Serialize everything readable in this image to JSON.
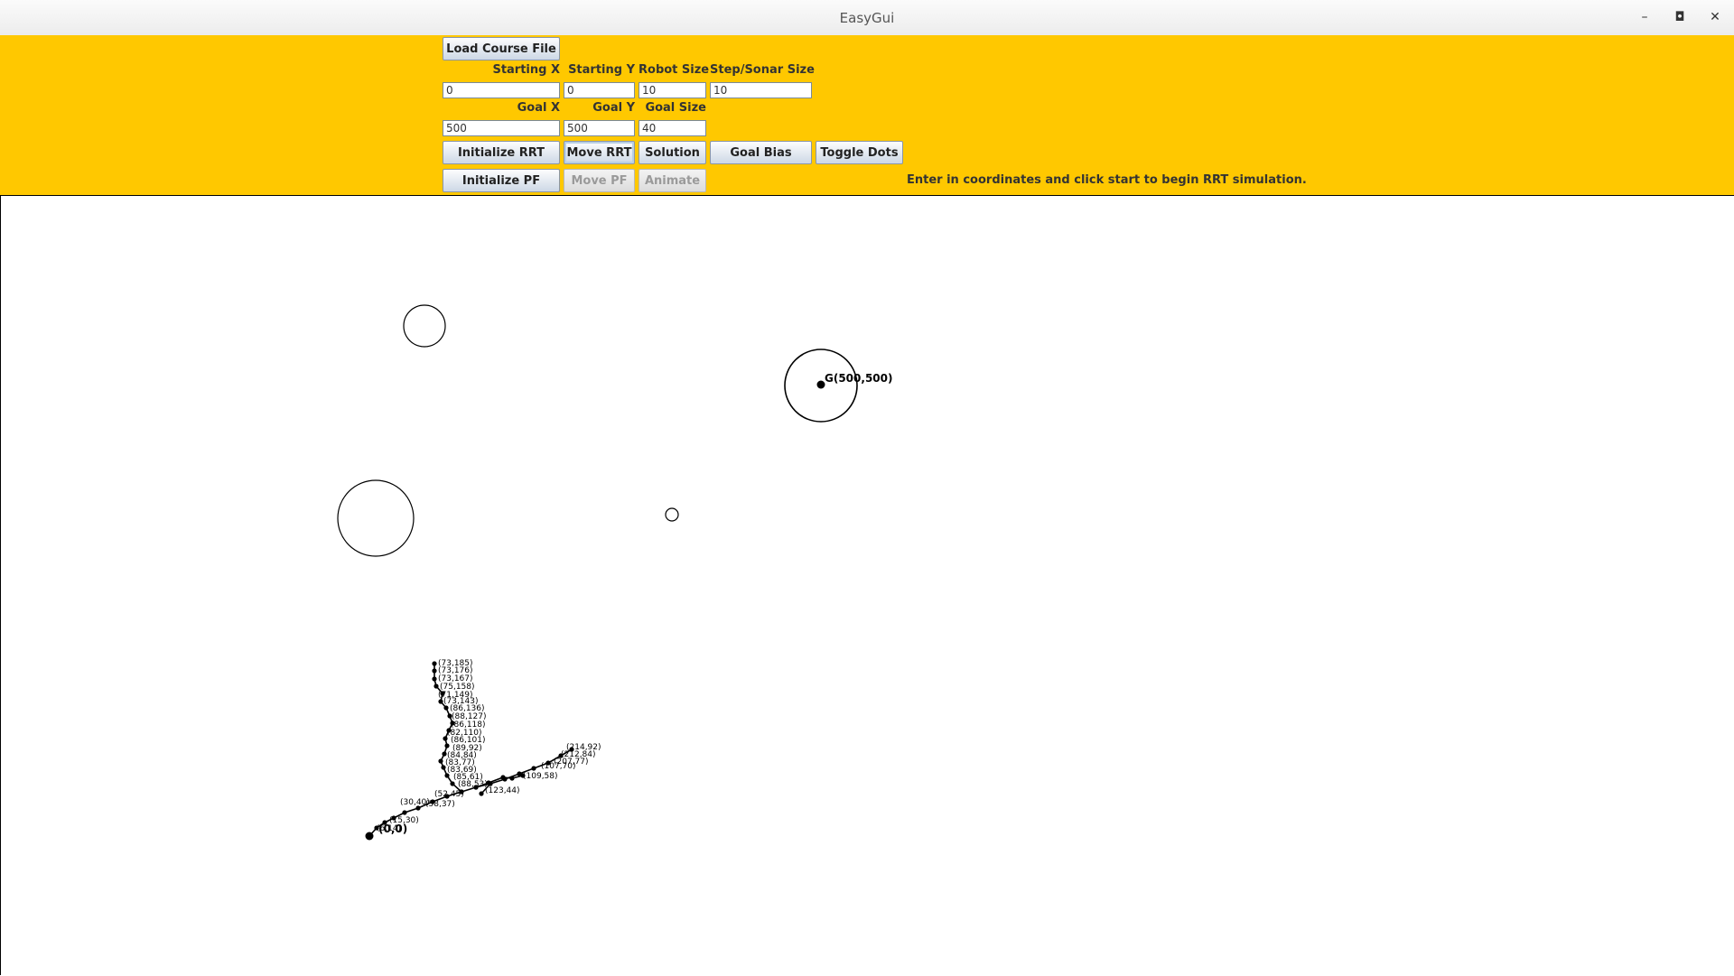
{
  "window": {
    "title": "EasyGui"
  },
  "toolbar": {
    "load_course_label": "Load Course File",
    "labels": {
      "start_x": "Starting X",
      "start_y": "Starting Y",
      "robot_size": "Robot Size",
      "step_sonar": "Step/Sonar Size",
      "goal_x": "Goal X",
      "goal_y": "Goal Y",
      "goal_size": "Goal Size"
    },
    "fields": {
      "start_x": "0",
      "start_y": "0",
      "robot_size": "10",
      "step_sonar": "10",
      "goal_x": "500",
      "goal_y": "500",
      "goal_size": "40"
    },
    "buttons": {
      "init_rrt": "Initialize RRT",
      "move_rrt": "Move RRT",
      "solution": "Solution",
      "goal_bias": "Goal Bias",
      "toggle_dots": "Toggle Dots",
      "init_pf": "Initialize PF",
      "move_pf": "Move PF",
      "animate": "Animate"
    },
    "status": "Enter in coordinates and click start to begin RRT simulation.",
    "colors": {
      "background": "#ffc800"
    }
  },
  "canvas": {
    "goal_label": "G(500,500)",
    "start_label": "(0,0)",
    "node_labels": [
      "(73,185)",
      "(73,176)",
      "(73,167)",
      "(75,158)",
      "(71,149)",
      "(73,143)",
      "(86,136)",
      "(88,127)",
      "(86,118)",
      "(82,110)",
      "(86,101)",
      "(89,92)",
      "(84,84)",
      "(83,77)",
      "(83,69)",
      "(85,61)",
      "(88,53)",
      "(123,44)",
      "(109,58)",
      "(107,70)",
      "(214,92)",
      "(212,84)",
      "(207,77)",
      "(52,45)",
      "(58,37)",
      "(30,40)",
      "(15,30)",
      "(6,14)"
    ]
  }
}
